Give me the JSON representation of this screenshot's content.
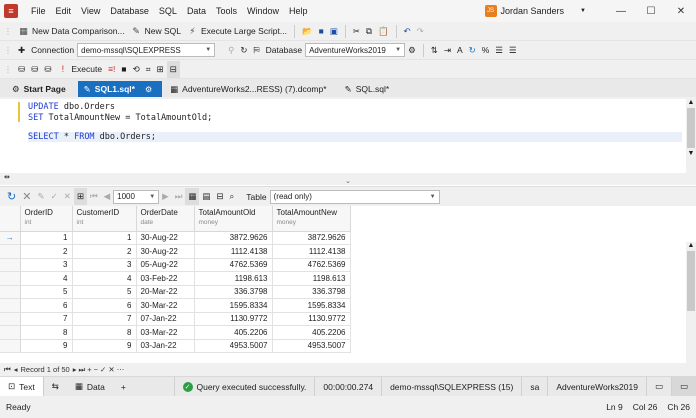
{
  "menu": [
    "File",
    "Edit",
    "View",
    "Database",
    "SQL",
    "Data",
    "Tools",
    "Window",
    "Help"
  ],
  "user": {
    "initials": "JS",
    "name": "Jordan Sanders"
  },
  "toolbar1": {
    "new_data_comparison": "New Data Comparison...",
    "new_sql": "New SQL",
    "execute_large_script": "Execute Large Script..."
  },
  "toolbar2": {
    "connection_label": "Connection",
    "connection_value": "demo-mssql\\SQLEXPRESS",
    "database_label": "Database",
    "database_value": "AdventureWorks2019"
  },
  "toolbar3": {
    "execute": "Execute"
  },
  "tabs": [
    {
      "label": "Start Page"
    },
    {
      "label": "SQL1.sql*"
    },
    {
      "label": "AdventureWorks2...RESS) (7).dcomp*"
    },
    {
      "label": "SQL.sql*"
    }
  ],
  "editor": {
    "line1_kw": "UPDATE",
    "line1_rest": " dbo.Orders",
    "line2_kw": "SET",
    "line2_rest": " TotalAmountNew = TotalAmountOld;",
    "line4_kw1": "SELECT",
    "line4_mid": " * ",
    "line4_kw2": "FROM",
    "line4_rest": " dbo.Orders;"
  },
  "results_toolbar": {
    "page_size": "1000",
    "view_label": "Table",
    "view_mode": "(read only)"
  },
  "grid": {
    "columns": [
      {
        "name": "OrderID",
        "type": "int"
      },
      {
        "name": "CustomerID",
        "type": "int"
      },
      {
        "name": "OrderDate",
        "type": "date"
      },
      {
        "name": "TotalAmountOld",
        "type": "money"
      },
      {
        "name": "TotalAmountNew",
        "type": "money"
      }
    ],
    "rows": [
      [
        "1",
        "1",
        "30-Aug-22",
        "3872.9626",
        "3872.9626"
      ],
      [
        "2",
        "2",
        "30-Aug-22",
        "1112.4138",
        "1112.4138"
      ],
      [
        "3",
        "3",
        "05-Aug-22",
        "4762.5369",
        "4762.5369"
      ],
      [
        "4",
        "4",
        "03-Feb-22",
        "1198.613",
        "1198.613"
      ],
      [
        "5",
        "5",
        "20-Mar-22",
        "336.3798",
        "336.3798"
      ],
      [
        "6",
        "6",
        "30-Mar-22",
        "1595.8334",
        "1595.8334"
      ],
      [
        "7",
        "7",
        "07-Jan-22",
        "1130.9772",
        "1130.9772"
      ],
      [
        "8",
        "8",
        "03-Mar-22",
        "405.2206",
        "405.2206"
      ],
      [
        "9",
        "9",
        "03-Jan-22",
        "4953.5007",
        "4953.5007"
      ]
    ]
  },
  "pager": {
    "record": "Record 1 of 50"
  },
  "bottom": {
    "text_tab": "Text",
    "data_tab": "Data",
    "status_message": "Query executed successfully.",
    "elapsed": "00:00:00.274",
    "server": "demo-mssql\\SQLEXPRESS (15)",
    "user": "sa",
    "database": "AdventureWorks2019"
  },
  "footer": {
    "status": "Ready",
    "ln": "Ln 9",
    "col": "Col 26",
    "ch": "Ch 26"
  }
}
